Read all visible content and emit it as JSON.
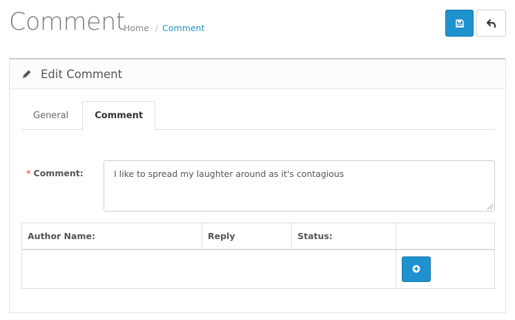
{
  "header": {
    "title": "Comment",
    "breadcrumb": [
      {
        "label": "Home"
      },
      {
        "separator": "/",
        "label": "Comment"
      }
    ]
  },
  "toolbar": {
    "save_icon": "save-icon",
    "back_icon": "reply-icon",
    "accent_color": "#1e91cf"
  },
  "panel": {
    "icon": "pencil-icon",
    "title": "Edit Comment",
    "tabs": [
      {
        "label": "General",
        "active": false
      },
      {
        "label": "Comment",
        "active": true
      }
    ]
  },
  "form": {
    "required_marker": "*",
    "comment_label": "Comment:",
    "comment_value": "I like to spread my laughter around as it's contagious"
  },
  "table": {
    "headers": [
      "Author Name:",
      "Reply",
      "Status:",
      ""
    ],
    "add_icon": "plus-circle-icon"
  }
}
